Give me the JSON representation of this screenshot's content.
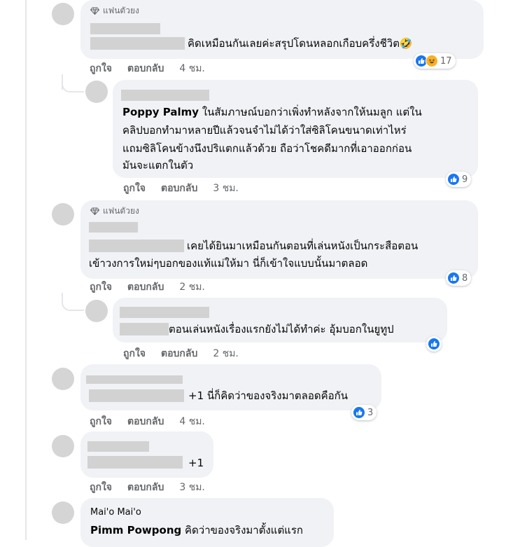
{
  "fan_badge_label": "แฟนตัวยง",
  "comments": [
    {
      "text_line": "คิดเหมือนกันเลยค่ะสรุปโดนหลอกเกือบครึ่งชีวิต🤣",
      "reaction_count": "17",
      "actions": {
        "like": "ถูกใจ",
        "reply": "ตอบกลับ",
        "time": "4 ชม."
      }
    },
    {
      "mention": "Poppy Palmy",
      "lines": [
        "ในสัมภาษณ์บอกว่าเพิ่งทำหลังจากให้นมลูก แต่ใน",
        "คลิปบอกทำมาหลายปีแล้วจนจำไม่ได้ว่าใส่ซิลิโคนขนาดเท่าไหร่",
        "แถมซิลิโคนข้างนึงปริแตกแล้วด้วย ถือว่าโชคดีมากที่เอาออกก่อน",
        "มันจะแตกในตัว"
      ],
      "reaction_count": "9",
      "actions": {
        "like": "ถูกใจ",
        "reply": "ตอบกลับ",
        "time": "3 ชม."
      }
    },
    {
      "lines": [
        "เคยได้ยินมาเหมือนกันตอนที่เล่นหนังเป็นกระสือตอน",
        "เข้าวงการใหม่ๆบอกของแท้แม่ให้มา นี่ก็เข้าใจแบบนั้นมาตลอด"
      ],
      "reaction_count": "8",
      "actions": {
        "like": "ถูกใจ",
        "reply": "ตอบกลับ",
        "time": "2 ชม."
      }
    },
    {
      "text_line": "ตอนเล่นหนังเรื่องแรกยังไม่ได้ทำค่ะ อุ้มบอกในยูทูป",
      "actions": {
        "like": "ถูกใจ",
        "reply": "ตอบกลับ",
        "time": "2 ชม."
      }
    },
    {
      "text_line": "+1 นี่ก็คิดว่าของจริงมาตลอดคือกัน",
      "reaction_count": "3",
      "actions": {
        "like": "ถูกใจ",
        "reply": "ตอบกลับ",
        "time": "4 ชม."
      }
    },
    {
      "text_line": "+1",
      "actions": {
        "like": "ถูกใจ",
        "reply": "ตอบกลับ",
        "time": "3 ชม."
      }
    },
    {
      "author": "Mai'o Mai'o",
      "mention": "Pimm Powpong",
      "text_line": "คิดว่าของจริงมาตั้งแต่แรก"
    }
  ],
  "colors": {
    "bubble": "#f0f2f5",
    "like_blue": "#1877f2",
    "haha_yellow": "#f7b125",
    "meta_gray": "#65676b"
  }
}
